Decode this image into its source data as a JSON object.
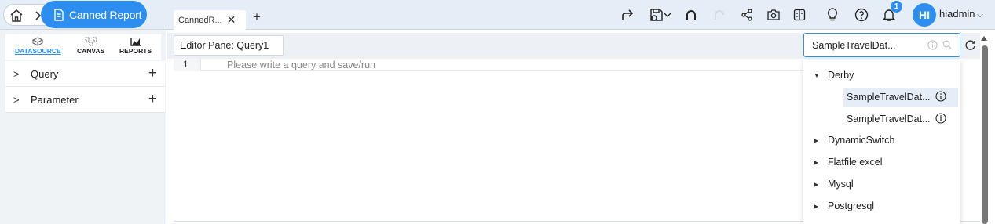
{
  "breadcrumb": {
    "current": "Canned Report"
  },
  "tabs": [
    {
      "label": "CannedR..."
    }
  ],
  "user": {
    "initials": "HI",
    "name": "hiadmin",
    "notification_count": "1"
  },
  "left_panel": {
    "tabs": [
      {
        "label": "DATASOURCE",
        "icon": "datasource-icon",
        "active": true
      },
      {
        "label": "CANVAS",
        "icon": "canvas-icon"
      },
      {
        "label": "REPORTS",
        "icon": "reports-icon"
      }
    ],
    "items": [
      {
        "label": "Query"
      },
      {
        "label": "Parameter"
      }
    ]
  },
  "editor": {
    "pane_title": "Editor Pane: Query1",
    "line_number": "1",
    "placeholder": "Please write a query and save/run"
  },
  "datasource_select": {
    "value": "SampleTravelDat...",
    "groups": [
      {
        "label": "Derby",
        "expanded": true,
        "items": [
          {
            "label": "SampleTravelDat...",
            "selected": true
          },
          {
            "label": "SampleTravelDat..."
          }
        ]
      },
      {
        "label": "DynamicSwitch"
      },
      {
        "label": "Flatfile excel"
      },
      {
        "label": "Mysql"
      },
      {
        "label": "Postgresql"
      }
    ]
  },
  "colors": {
    "accent": "#2d8ef0",
    "topbar": "#e5eef7",
    "panel": "#f0f3f6"
  }
}
